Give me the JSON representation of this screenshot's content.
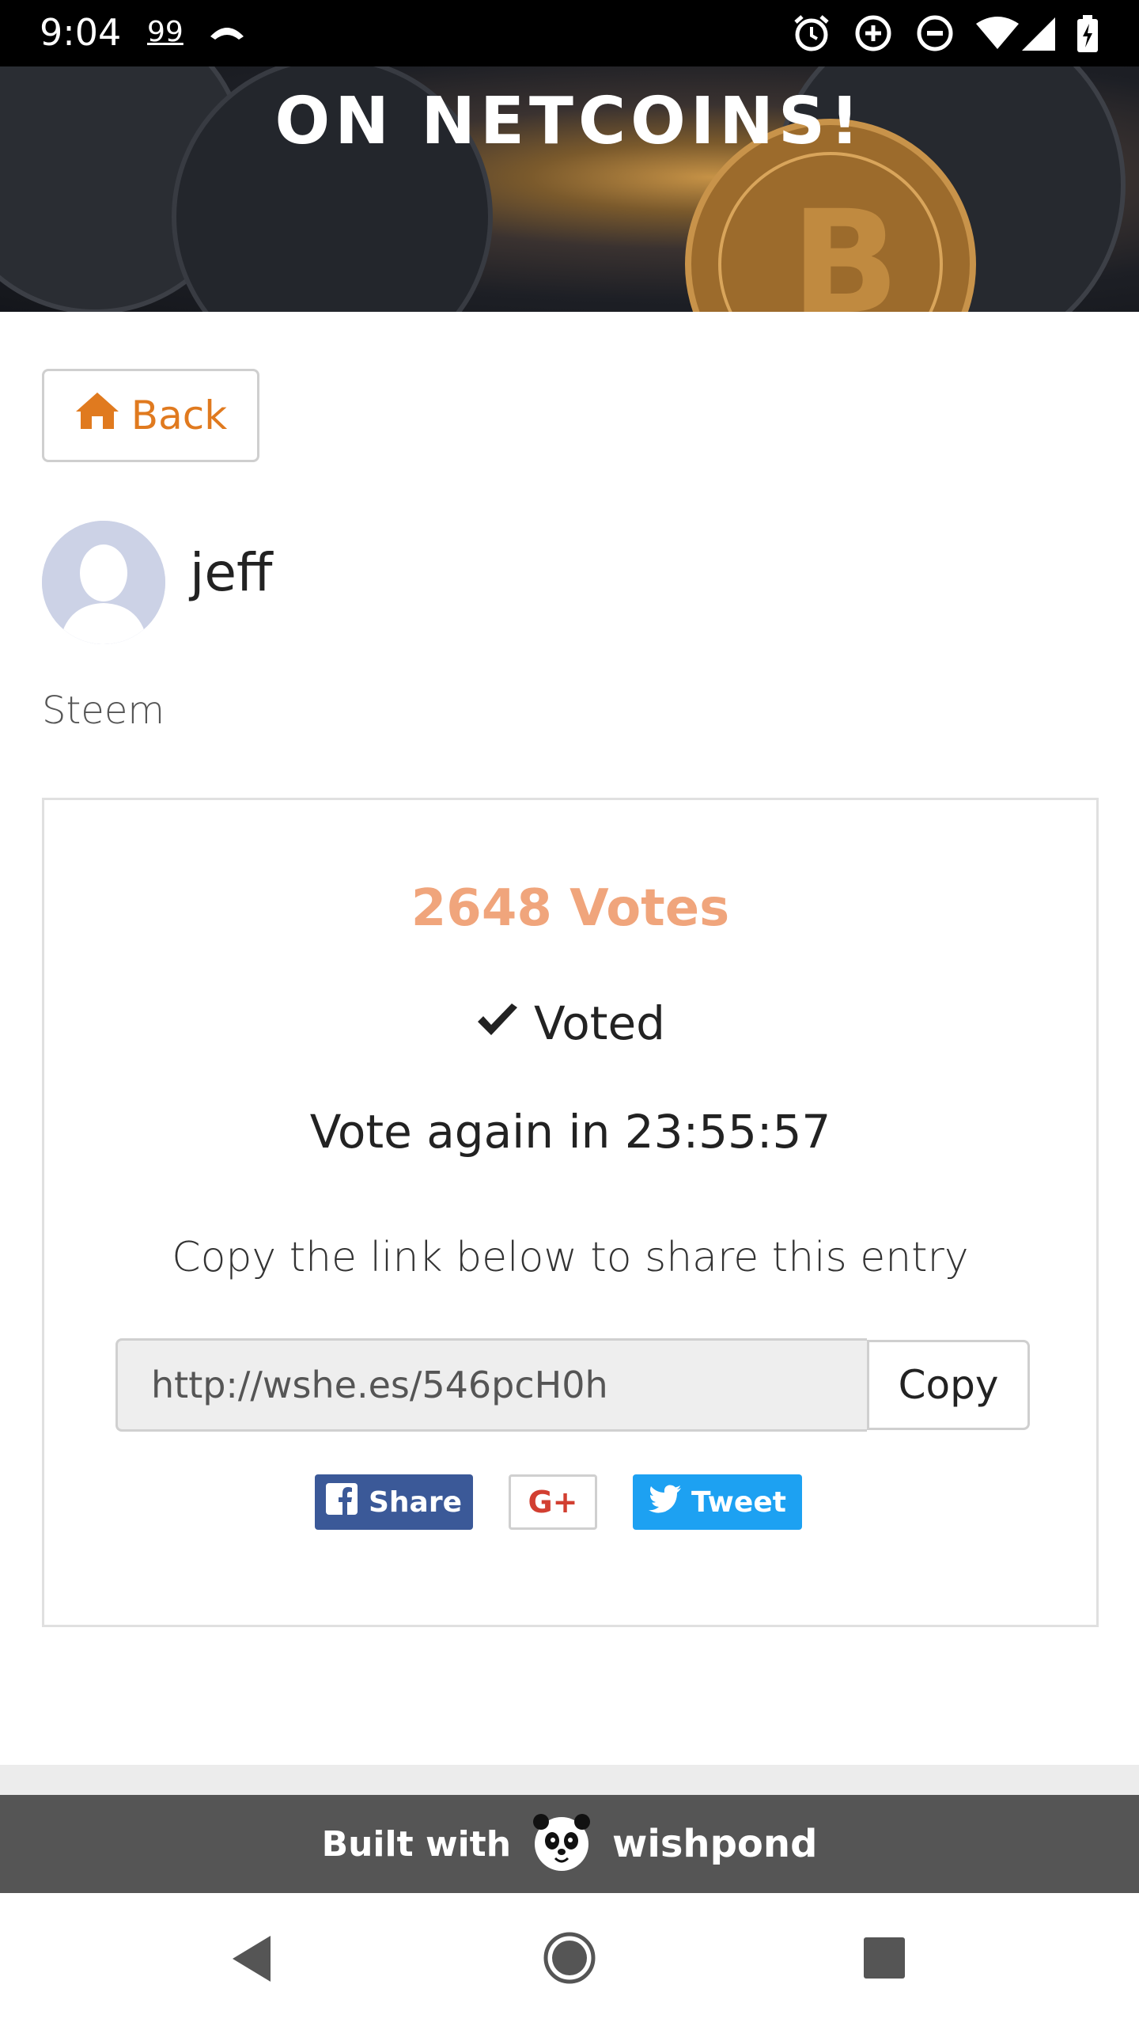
{
  "status_bar": {
    "time": "9:04",
    "notification": "99"
  },
  "banner": {
    "title": "ON NETCOINS!"
  },
  "back_button": {
    "label": "Back"
  },
  "entry": {
    "username": "jeff",
    "description": "Steem"
  },
  "vote_card": {
    "votes": "2648 Votes",
    "voted_label": "Voted",
    "vote_again": "Vote again in 23:55:57",
    "share_hint": "Copy the link below to share this entry",
    "share_link": "http://wshe.es/546pcH0h",
    "copy_label": "Copy",
    "facebook_label": "Share",
    "googleplus_label": "G+",
    "twitter_label": "Tweet"
  },
  "footer": {
    "built_with": "Built with",
    "brand": "wishpond"
  },
  "colors": {
    "accent": "#e07a1f",
    "votes": "#f0a57c",
    "facebook": "#3b5998",
    "twitter": "#1da1f2",
    "footer": "#555555"
  }
}
